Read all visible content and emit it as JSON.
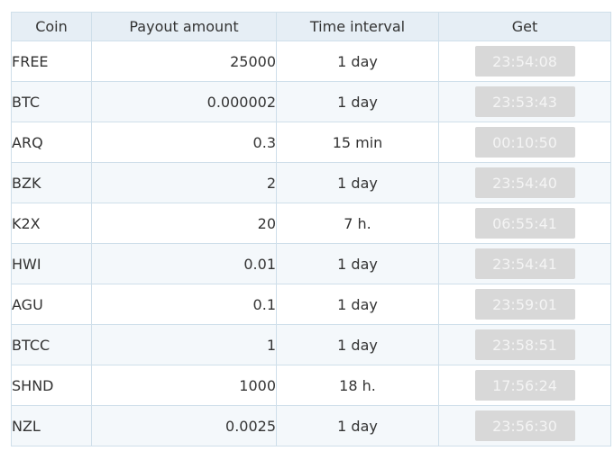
{
  "table": {
    "headers": {
      "coin": "Coin",
      "amount": "Payout amount",
      "interval": "Time interval",
      "get": "Get"
    },
    "rows": [
      {
        "coin": "FREE",
        "amount": "25000",
        "interval": "1 day",
        "timer": "23:54:08"
      },
      {
        "coin": "BTC",
        "amount": "0.000002",
        "interval": "1 day",
        "timer": "23:53:43"
      },
      {
        "coin": "ARQ",
        "amount": "0.3",
        "interval": "15 min",
        "timer": "00:10:50"
      },
      {
        "coin": "BZK",
        "amount": "2",
        "interval": "1 day",
        "timer": "23:54:40"
      },
      {
        "coin": "K2X",
        "amount": "20",
        "interval": "7 h.",
        "timer": "06:55:41"
      },
      {
        "coin": "HWI",
        "amount": "0.01",
        "interval": "1 day",
        "timer": "23:54:41"
      },
      {
        "coin": "AGU",
        "amount": "0.1",
        "interval": "1 day",
        "timer": "23:59:01"
      },
      {
        "coin": "BTCC",
        "amount": "1",
        "interval": "1 day",
        "timer": "23:58:51"
      },
      {
        "coin": "SHND",
        "amount": "1000",
        "interval": "18 h.",
        "timer": "17:56:24"
      },
      {
        "coin": "NZL",
        "amount": "0.0025",
        "interval": "1 day",
        "timer": "23:56:30"
      }
    ]
  },
  "colors": {
    "header_bg": "#e6eef5",
    "border": "#cfdfea",
    "row_alt_bg": "#f4f8fb",
    "button_bg": "#d8d8d8",
    "button_text": "#f4f4f4"
  }
}
